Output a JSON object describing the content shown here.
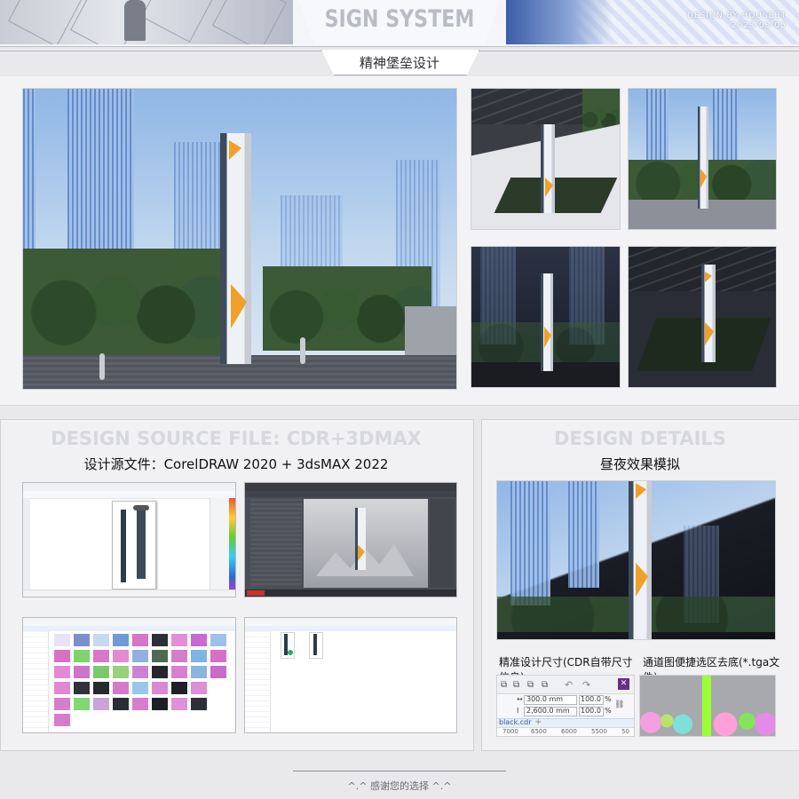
{
  "header": {
    "title": "SIGN SYSTEM",
    "byline_line1": "DESIGN BY HOUSEBT",
    "byline_line2": "2023-03-05",
    "subtitle": "精神堡垒设计"
  },
  "source_section": {
    "ghost_title": "DESIGN SOURCE FILE: CDR+3DMAX",
    "title": "设计源文件：CorelDRAW 2020  +  3dsMAX 2022"
  },
  "details_section": {
    "ghost_title": "DESIGN DETAILS",
    "title": "昼夜效果模拟",
    "caption_left": "精准设计尺寸(CDR自带尺寸信息)",
    "caption_right": "通道图便捷选区去底(*.tga文件)"
  },
  "dimensions": {
    "width_value": "300.0 mm",
    "height_value": "2,600.0 mm",
    "scale_x": "100.0",
    "scale_y": "100.0",
    "percent": "%",
    "filename": "black.cdr",
    "ruler_ticks": [
      "7000",
      "6500",
      "6000",
      "5500",
      "50"
    ]
  },
  "footer": {
    "text": "^.^  感谢您的选择  ^.^"
  },
  "colors": {
    "accent_orange": "#f0a028",
    "sky_blue": "#8fb6e6",
    "panel_bg": "#f1f1f3"
  }
}
